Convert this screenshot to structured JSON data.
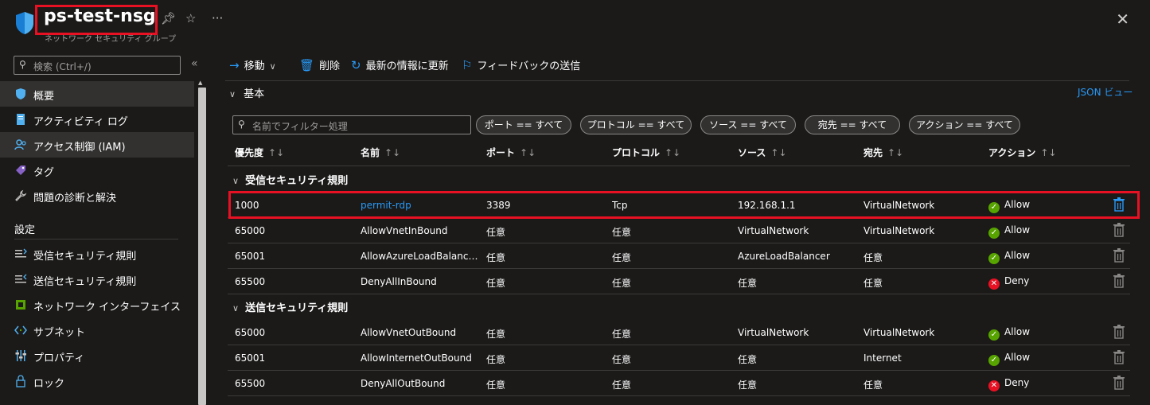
{
  "header": {
    "title": "ps-test-nsg",
    "subtitle": "ネットワーク セキュリティ グループ",
    "pin_icon": "pin-icon",
    "star_icon": "star-icon",
    "more": "···",
    "close": "✕"
  },
  "sidebar": {
    "search_placeholder": "検索 (Ctrl+/)",
    "collapse": "«",
    "items": [
      {
        "label": "概要",
        "icon": "shield-icon",
        "active": true
      },
      {
        "label": "アクティビティ ログ",
        "icon": "log-icon",
        "active": false
      },
      {
        "label": "アクセス制御 (IAM)",
        "icon": "iam-icon",
        "active": true
      },
      {
        "label": "タグ",
        "icon": "tag-icon",
        "active": false
      },
      {
        "label": "問題の診断と解決",
        "icon": "wrench-icon",
        "active": false
      }
    ],
    "settings_heading": "設定",
    "settings_items": [
      {
        "label": "受信セキュリティ規則",
        "icon": "inbound-icon"
      },
      {
        "label": "送信セキュリティ規則",
        "icon": "outbound-icon"
      },
      {
        "label": "ネットワーク インターフェイス",
        "icon": "nic-icon"
      },
      {
        "label": "サブネット",
        "icon": "subnet-icon"
      },
      {
        "label": "プロパティ",
        "icon": "properties-icon"
      },
      {
        "label": "ロック",
        "icon": "lock-icon"
      }
    ]
  },
  "toolbar": {
    "move": "移動",
    "delete": "削除",
    "refresh": "最新の情報に更新",
    "feedback": "フィードバックの送信"
  },
  "basics": {
    "label": "基本",
    "json_view": "JSON ビュー"
  },
  "filter": {
    "placeholder": "名前でフィルター処理",
    "pills": [
      "ポート == すべて",
      "プロトコル == すべて",
      "ソース == すべて",
      "宛先 == すべて",
      "アクション == すべて"
    ]
  },
  "columns": [
    "優先度",
    "名前",
    "ポート",
    "プロトコル",
    "ソース",
    "宛先",
    "アクション"
  ],
  "sort_glyph": "↑↓",
  "inbound": {
    "label": "受信セキュリティ規則",
    "rows": [
      {
        "priority": "1000",
        "name": "permit-rdp",
        "port": "3389",
        "protocol": "Tcp",
        "source": "192.168.1.1",
        "dest": "VirtualNetwork",
        "action": "Allow",
        "link": true
      },
      {
        "priority": "65000",
        "name": "AllowVnetInBound",
        "port": "任意",
        "protocol": "任意",
        "source": "VirtualNetwork",
        "dest": "VirtualNetwork",
        "action": "Allow",
        "link": false
      },
      {
        "priority": "65001",
        "name": "AllowAzureLoadBalancerInBound",
        "port": "任意",
        "protocol": "任意",
        "source": "AzureLoadBalancer",
        "dest": "任意",
        "action": "Allow",
        "link": false
      },
      {
        "priority": "65500",
        "name": "DenyAllInBound",
        "port": "任意",
        "protocol": "任意",
        "source": "任意",
        "dest": "任意",
        "action": "Deny",
        "link": false
      }
    ]
  },
  "outbound": {
    "label": "送信セキュリティ規則",
    "rows": [
      {
        "priority": "65000",
        "name": "AllowVnetOutBound",
        "port": "任意",
        "protocol": "任意",
        "source": "VirtualNetwork",
        "dest": "VirtualNetwork",
        "action": "Allow",
        "link": false
      },
      {
        "priority": "65001",
        "name": "AllowInternetOutBound",
        "port": "任意",
        "protocol": "任意",
        "source": "任意",
        "dest": "Internet",
        "action": "Allow",
        "link": false
      },
      {
        "priority": "65500",
        "name": "DenyAllOutBound",
        "port": "任意",
        "protocol": "任意",
        "source": "任意",
        "dest": "任意",
        "action": "Deny",
        "link": false
      }
    ]
  },
  "colors": {
    "accent": "#2899f5",
    "allow": "#57a300",
    "deny": "#e81123",
    "highlight": "#e81123"
  }
}
